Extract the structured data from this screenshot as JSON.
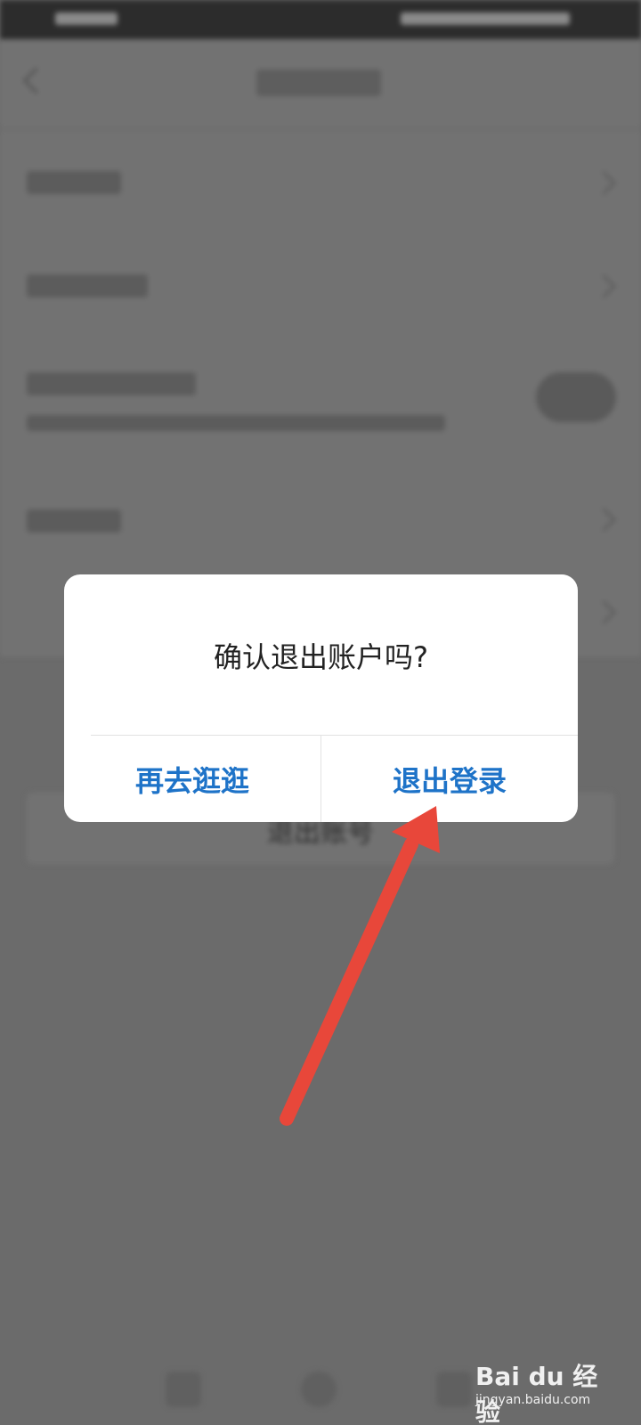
{
  "background": {
    "logout_button_label": "退出账号"
  },
  "dialog": {
    "message": "确认退出账户吗?",
    "cancel_label": "再去逛逛",
    "confirm_label": "退出登录"
  },
  "watermark": {
    "logo": "Bai du 经验",
    "url": "jingyan.baidu.com"
  },
  "colors": {
    "accent": "#1e73c8",
    "annotation_arrow": "#e8473a",
    "overlay": "#6b6b6b"
  },
  "icons": [
    "back-chevron-icon",
    "chevron-right-icon",
    "toggle-switch-icon",
    "red-arrow-annotation"
  ]
}
